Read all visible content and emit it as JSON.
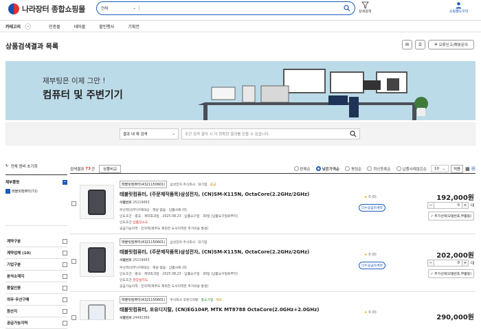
{
  "header": {
    "site_name": "나라장터 종합쇼핑몰",
    "search_category": "전체",
    "search_placeholder": "",
    "detail_search": "상세검색",
    "mall_guide": "쇼핑몰도우미"
  },
  "nav": {
    "category": "카테고리",
    "menus": [
      "인증몰",
      "테마몰",
      "할인행사",
      "기획전"
    ]
  },
  "page": {
    "title": "상품검색결과 목록",
    "report_label": "오류신고/해봇문의"
  },
  "banner": {
    "line1": "재부팅은 이제 그만 !",
    "line2": "컴퓨터 및 주변기기"
  },
  "filter": {
    "scope": "결과 내 재 검색",
    "placeholder": "조건 검색 결익 시 더 정확한 결과를 얻을 수 있습니다."
  },
  "sidebar": {
    "reset": "전체 원비 초기화",
    "maker_label": "제부품명",
    "maker_option": "태블릿컴퓨터(72)",
    "rows": [
      "계약구분",
      "계약업체 (10)",
      "기업구분",
      "분석소재지",
      "품질인증",
      "의무·우선구매",
      "원산지",
      "공급가능지역"
    ]
  },
  "results": {
    "count_label": "검색결과",
    "count": "73",
    "count_unit": "건",
    "compare": "상품비교",
    "sorts": [
      "판매순",
      "낮은가격순",
      "평점순",
      "최신등록순",
      "납품사례많은순"
    ],
    "per_page": "10",
    "apply": "적용"
  },
  "products": [
    {
      "category_tag": "태블릿컴퓨터(4321150601)",
      "vendor": "삼성전자 주식회사",
      "badge1": "대기업",
      "badge2": "공급",
      "name": "태블릿컴퓨터, (주문제작품목)삼성전자, (CN)SM-X115N, OctaCore(2.2GHz/2GHz)",
      "id_label": "식별번호",
      "id": "25219663",
      "meta1": "우선적(의무)구매대상 · 해당 없음 · 납품사례 (0)",
      "meta2": "인도조건 · 중국 · 계약효과일 · 2025.08.23 · 납품요구일 · 30일 (납품요구일로부터)",
      "cond": "인도조건",
      "cond_val": "납품장소도",
      "supply": "공급가능지역 · 전지역(제주도 제외한 도서지역은 추가비용 발생)",
      "rating": "0 (0)",
      "delivery_tag": "다수공급자계약",
      "price": "192,000원",
      "qty": "0",
      "qty_unit": "대",
      "add_label": "추가선택(모델번호,부품등)"
    },
    {
      "category_tag": "태블릿컴퓨터(4321150601)",
      "vendor": "삼성전자 주식회사",
      "badge1": "대기업",
      "badge2": "",
      "name": "태블릿컴퓨터, (주문제작품목)삼성전자, (CN)SM-X115N, OctaCore(2.2GHz/2GHz)",
      "id_label": "식별번호",
      "id": "25219663",
      "meta1": "우선적(의무)구매대상 · 해당 없음 · 납품사례 (0)",
      "meta2": "인도조건 · 중국 · 계약효과일 · 2025.08.23 · 납품요구일 · 30일 (납품요구일로부터)",
      "cond": "인도조건",
      "cond_val": "현장설치도",
      "supply": "공급가능지역 · 전지역(제주도 제외한 도서지역은 추가비용 발생)",
      "rating": "0 (0)",
      "delivery_tag": "다수공급자계약",
      "price": "202,000원",
      "qty": "0",
      "qty_unit": "대",
      "add_label": "추가선택(모델번호,부품등)"
    },
    {
      "category_tag": "태블릿컴퓨터(4321150601)",
      "vendor": "주식회사 포유디지탈",
      "badge1": "중소기업",
      "badge2": "제조",
      "name": "태블릿컴퓨터, 포유디지탈, (CN)EG104P, MTK MT8788 OctaCore(2.0GHz+2.0GHz)",
      "id_label": "식별번호",
      "id": "24492369",
      "rating": "0 (0)",
      "price": "290,000원"
    }
  ]
}
